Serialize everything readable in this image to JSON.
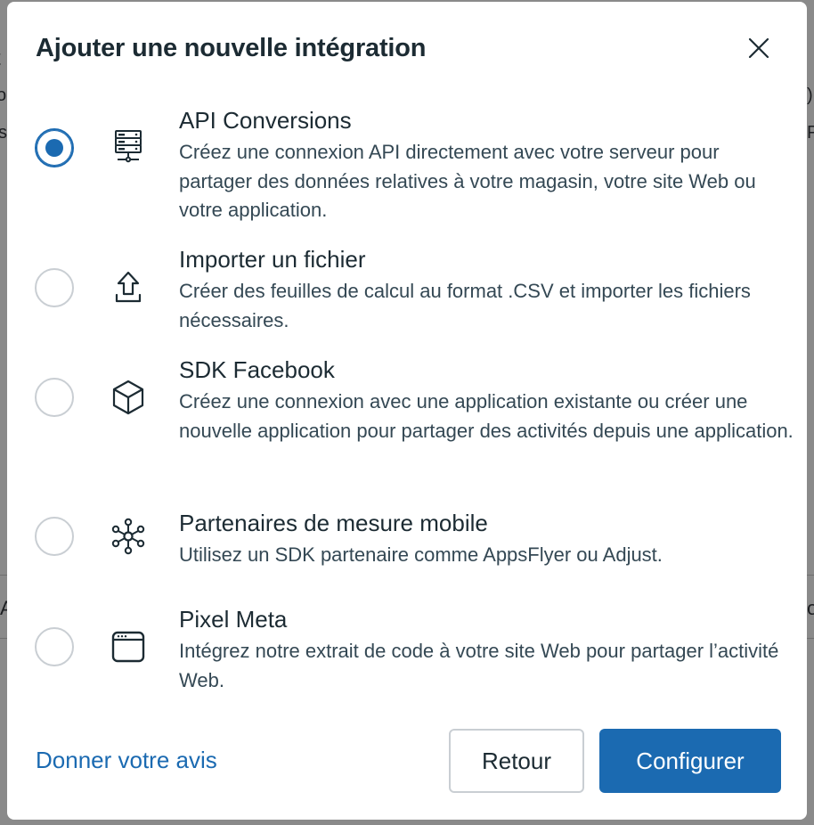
{
  "dialog": {
    "title": "Ajouter une nouvelle intégration",
    "close_icon": "close-icon"
  },
  "options": [
    {
      "title": "API Conversions",
      "description": "Créez une connexion API directement avec votre serveur pour partager des données relatives à votre magasin, votre site Web ou votre application.",
      "icon": "server-icon",
      "selected": true
    },
    {
      "title": "Importer un fichier",
      "description": "Créer des feuilles de calcul au format .CSV et importer les fichiers nécessaires.",
      "icon": "upload-icon",
      "selected": false
    },
    {
      "title": "SDK Facebook",
      "description": "Créez une connexion avec une application existante ou créer une nouvelle application pour partager des activités depuis une application.",
      "icon": "cube-icon",
      "selected": false
    },
    {
      "title": "Partenaires de mesure mobile",
      "description": "Utilisez un SDK partenaire comme AppsFlyer ou Adjust.",
      "icon": "network-hub-icon",
      "selected": false
    },
    {
      "title": "Pixel Meta",
      "description": "Intégrez notre extrait de code à votre site Web pour partager l’activité Web.",
      "icon": "browser-window-icon",
      "selected": false
    }
  ],
  "footer": {
    "feedback_link": "Donner votre avis",
    "back_button": "Retour",
    "configure_button": "Configurer"
  },
  "colors": {
    "accent": "#1b6ab1",
    "text_primary": "#1c2b33",
    "text_secondary": "#344854",
    "border": "#c9ced3"
  }
}
